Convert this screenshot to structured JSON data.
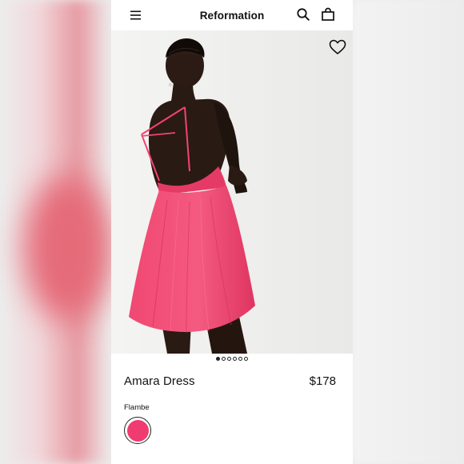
{
  "header": {
    "brand": "Reformation",
    "menu_icon": "hamburger-menu-icon",
    "search_icon": "search-icon",
    "bag_icon": "shopping-bag-icon"
  },
  "gallery": {
    "favorite_icon": "heart-icon",
    "image_count": 6,
    "active_index": 0
  },
  "product": {
    "name": "Amara Dress",
    "price": "$178"
  },
  "color": {
    "label": "Flambe",
    "swatch_hex": "#ef3b6f"
  },
  "colors": {
    "dress": "#f2446f",
    "dress_shade": "#d92f5c",
    "skin": "#2a1a14",
    "background": "#f0f0ee"
  }
}
